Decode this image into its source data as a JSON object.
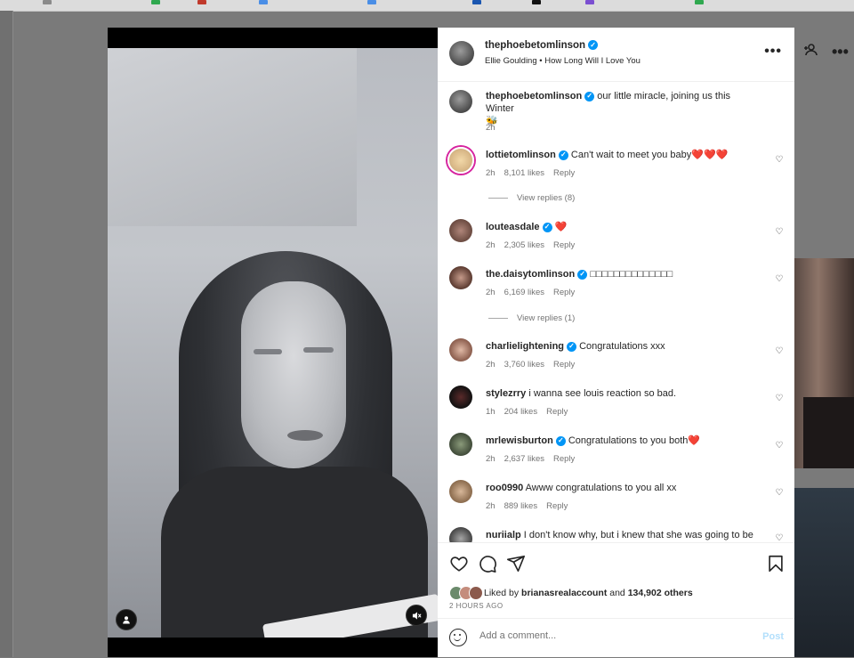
{
  "colors": {
    "accent": "#0095f6",
    "heart_red": "#ed1c24",
    "post_disabled": "#b2dffc"
  },
  "header": {
    "username": "thephoebetomlinson",
    "music": "Ellie Goulding • How Long Will I Love You"
  },
  "caption": {
    "username": "thephoebetomlinson",
    "text": "our little miracle, joining us this Winter",
    "emoji": "🐝",
    "time": "2h"
  },
  "comments": [
    {
      "username": "lottietomlinson",
      "verified": true,
      "text": "Can't wait to meet you baby",
      "hearts": "❤️❤️❤️",
      "time": "2h",
      "likes": "8,101 likes",
      "reply": "Reply",
      "view_replies": "View replies (8)",
      "story_ring": true
    },
    {
      "username": "louteasdale",
      "verified": true,
      "text": "",
      "hearts": "❤️",
      "time": "2h",
      "likes": "2,305 likes",
      "reply": "Reply"
    },
    {
      "username": "the.daisytomlinson",
      "verified": true,
      "text": "□□□□□□□□□□□□□□",
      "hearts": "",
      "time": "2h",
      "likes": "6,169 likes",
      "reply": "Reply",
      "view_replies": "View replies (1)"
    },
    {
      "username": "charlielightening",
      "verified": true,
      "text": "Congratulations xxx",
      "hearts": "",
      "time": "2h",
      "likes": "3,760 likes",
      "reply": "Reply"
    },
    {
      "username": "stylezrry",
      "verified": false,
      "text": "i wanna see louis reaction so bad.",
      "hearts": "",
      "time": "1h",
      "likes": "204 likes",
      "reply": "Reply"
    },
    {
      "username": "mrlewisburton",
      "verified": true,
      "text": "Congratulations to you both",
      "hearts": "❤️",
      "time": "2h",
      "likes": "2,637 likes",
      "reply": "Reply"
    },
    {
      "username": "roo0990",
      "verified": false,
      "text": "Awww congratulations to you all xx",
      "hearts": "",
      "time": "2h",
      "likes": "889 likes",
      "reply": "Reply"
    },
    {
      "username": "nuriialp",
      "verified": false,
      "text": "I don't know why, but i knew that she was going to be",
      "hearts": "",
      "time": "",
      "likes": "",
      "reply": ""
    }
  ],
  "likes_bar": {
    "prefix": "Liked by",
    "user": "brianasrealaccount",
    "joiner": "and",
    "others": "134,902 others",
    "time_ago": "2 HOURS AGO"
  },
  "add_comment": {
    "placeholder": "Add a comment...",
    "post_label": "Post"
  },
  "icons": [
    "heart-icon",
    "comment-icon",
    "share-icon",
    "bookmark-icon",
    "emoji-icon",
    "more-icon",
    "mute-icon",
    "user-tag-icon"
  ]
}
